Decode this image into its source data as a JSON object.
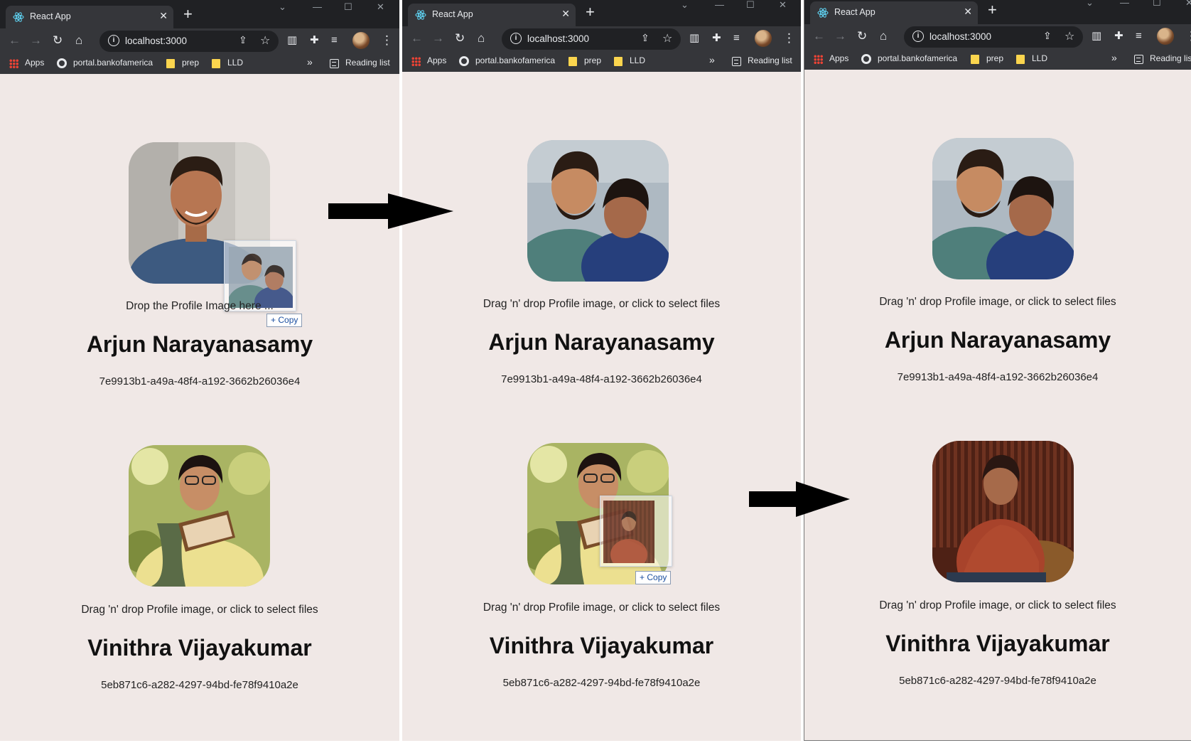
{
  "browser": {
    "tab_title": "React App",
    "tab_close": "✕",
    "new_tab": "+",
    "url": "localhost:3000",
    "win_min": "—",
    "win_max": "☐",
    "win_close": "✕",
    "tab_search": "⌄",
    "bookmarks": {
      "apps": "Apps",
      "portal": "portal.bankofamerica",
      "prep": "prep",
      "lld": "LLD",
      "overflow": "»",
      "reading_list": "Reading list"
    }
  },
  "profiles": [
    {
      "name": "Arjun Narayanasamy",
      "id": "7e9913b1-a49a-48f4-a192-3662b26036e4"
    },
    {
      "name": "Vinithra Vijayakumar",
      "id": "5eb871c6-a282-4297-94bd-fe78f9410a2e"
    }
  ],
  "dropzone": {
    "idle_text": "Drag 'n' drop Profile image, or click to select files",
    "active_text": "Drop the Profile Image here ..."
  },
  "drag": {
    "copy_label": "Copy",
    "copy_plus": "+"
  },
  "colors": {
    "page_background": "#f0e8e6",
    "chrome_frame": "#202124",
    "chrome_toolbar": "#35363a",
    "arrow": "#000000",
    "copy_text": "#1b4fa0"
  }
}
